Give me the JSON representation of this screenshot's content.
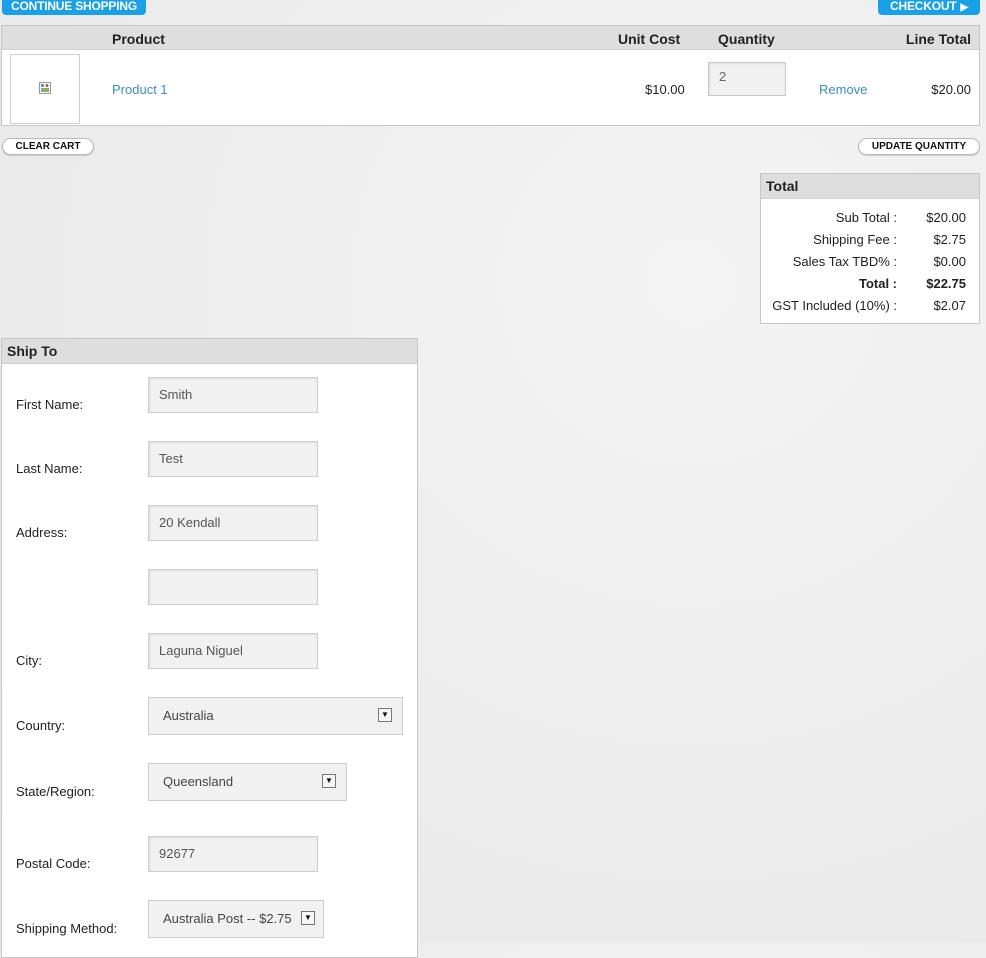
{
  "toolbar": {
    "continue_label": "CONTINUE SHOPPING",
    "checkout_label": "CHECKOUT",
    "checkout_arrow": "▶"
  },
  "cart": {
    "headers": {
      "product": "Product",
      "unit_cost": "Unit Cost",
      "quantity": "Quantity",
      "line_total": "Line Total"
    },
    "items": [
      {
        "name": "Product 1",
        "unit_cost": "$10.00",
        "quantity": "2",
        "remove_label": "Remove",
        "line_total": "$20.00"
      }
    ],
    "clear_label": "CLEAR CART",
    "update_label": "UPDATE QUANTITY"
  },
  "totals": {
    "title": "Total",
    "rows": [
      {
        "label": "Sub Total :",
        "value": "$20.00"
      },
      {
        "label": "Shipping Fee :",
        "value": "$2.75"
      },
      {
        "label": "Sales Tax TBD% :",
        "value": "$0.00"
      },
      {
        "label": "Total :",
        "value": "$22.75"
      },
      {
        "label": "GST Included (10%) :",
        "value": "$2.07"
      }
    ]
  },
  "shipto": {
    "title": "Ship To",
    "first_name_label": "First Name:",
    "first_name_value": "Smith",
    "last_name_label": "Last Name:",
    "last_name_value": "Test",
    "address_label": "Address:",
    "address1_value": "20 Kendall",
    "address2_value": "",
    "city_label": "City:",
    "city_value": "Laguna Niguel",
    "country_label": "Country:",
    "country_value": "Australia",
    "state_label": "State/Region:",
    "state_value": "Queensland",
    "postal_label": "Postal Code:",
    "postal_value": "92677",
    "shipping_label": "Shipping Method:",
    "shipping_value": "Australia Post -- $2.75",
    "dropdown_glyph": "▼"
  },
  "icons": {
    "product_image": "broken-image-icon",
    "dropdown": "chevron-down-icon"
  },
  "colors": {
    "accent": "#1aa0e6",
    "link": "#3a8dc0"
  }
}
